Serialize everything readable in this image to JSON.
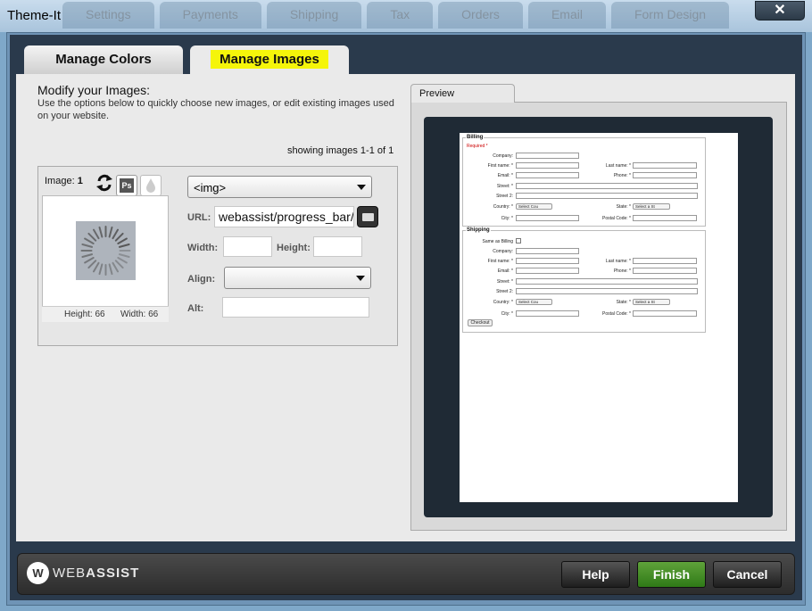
{
  "window": {
    "title": "Theme-It",
    "close_glyph": "✕",
    "background_tabs": [
      "Settings",
      "Payments",
      "Shipping",
      "Tax",
      "Orders",
      "Email",
      "Form Design"
    ]
  },
  "tabs": [
    {
      "label": "Manage Colors",
      "active": false
    },
    {
      "label": "Manage Images",
      "active": true,
      "highlight": "#f5f50a"
    }
  ],
  "images_panel": {
    "heading": "Modify your Images:",
    "description": "Use the options below to quickly choose new images, or edit existing images used on your website.",
    "showing": "showing images 1-1 of 1",
    "image_label": "Image:",
    "image_number": "1",
    "icons": [
      "refresh-icon",
      "photoshop-icon",
      "drop-icon"
    ],
    "ps_icon_text": "Ps",
    "thumb_height": "Height: 66",
    "thumb_width": "Width: 66",
    "tag_select_value": "<img>",
    "url_label": "URL:",
    "url_value": "webassist/progress_bar/",
    "width_label": "Width:",
    "width_value": "",
    "height_label": "Height:",
    "height_value": "",
    "align_label": "Align:",
    "align_value": "",
    "alt_label": "Alt:",
    "alt_value": ""
  },
  "preview": {
    "tab_label": "Preview",
    "billing": {
      "legend": "Billing",
      "required": "Required *",
      "labels": {
        "company": "Company:",
        "first_name": "First name: *",
        "last_name": "Last name: *",
        "email": "Email: *",
        "phone": "Phone: *",
        "street": "Street: *",
        "street2": "Street 2:",
        "country": "Country: *",
        "state": "State: *",
        "city": "City: *",
        "postal": "Postal Code: *"
      },
      "country_select": "Select Cou",
      "state_select": "Select a St"
    },
    "shipping": {
      "legend": "Shipping",
      "same_as_billing": "Same as Billing",
      "labels": {
        "company": "Company:",
        "first_name": "First name: *",
        "last_name": "Last name: *",
        "email": "Email: *",
        "phone": "Phone: *",
        "street": "Street: *",
        "street2": "Street 2:",
        "country": "Country: *",
        "state": "State: *",
        "city": "City: *",
        "postal": "Postal Code: *"
      },
      "country_select": "Select Cou",
      "state_select": "Select a St",
      "checkout": "Checkout"
    }
  },
  "footer": {
    "logo_mark": "W",
    "logo_web": "WEB",
    "logo_assist": "ASSIST",
    "help": "Help",
    "finish": "Finish",
    "cancel": "Cancel"
  },
  "colors": {
    "finish_button": "#3f8c22",
    "dialog_dark": "#2a3a4c",
    "highlight": "#f5f50a"
  }
}
